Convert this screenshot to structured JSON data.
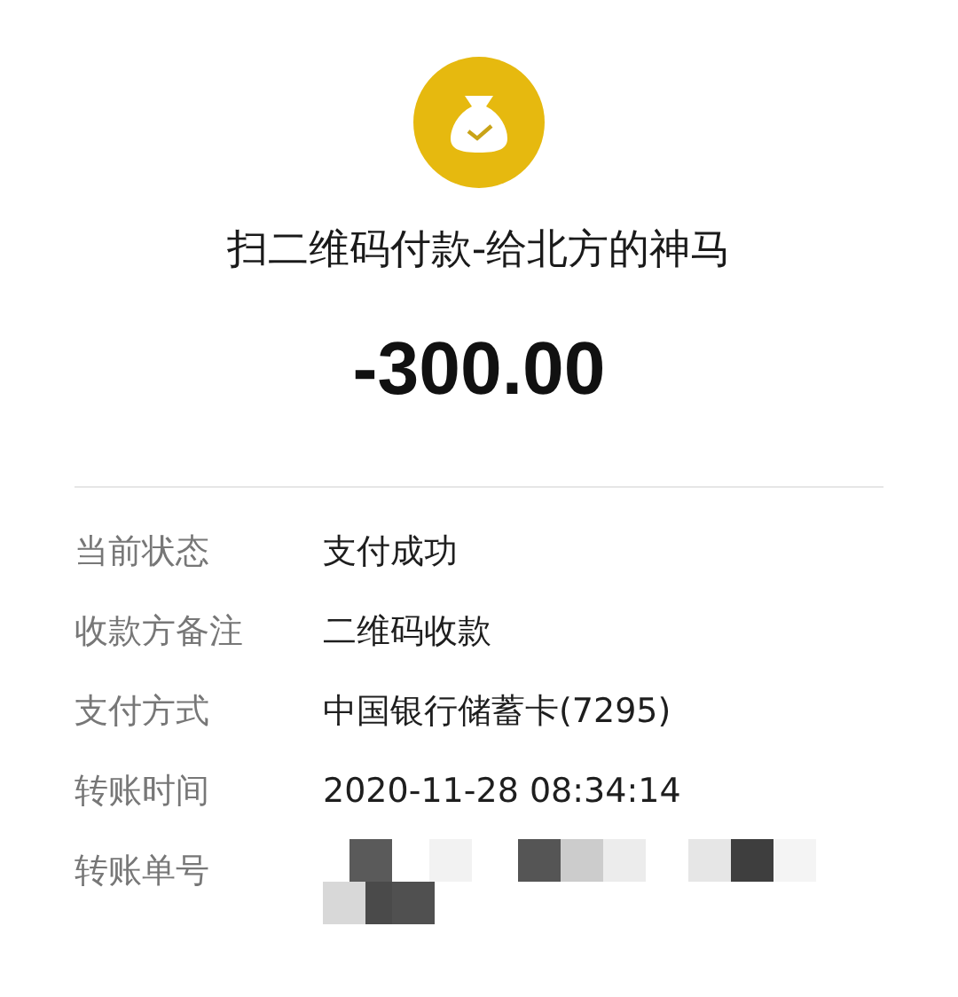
{
  "title": "扫二维码付款-给北方的神马",
  "amount": "-300.00",
  "details": [
    {
      "kind": "text",
      "label": "当前状态",
      "value": "支付成功"
    },
    {
      "kind": "text",
      "label": "收款方备注",
      "value": "二维码收款"
    },
    {
      "kind": "text",
      "label": "支付方式",
      "value": "中国银行储蓄卡(7295)"
    },
    {
      "kind": "text",
      "label": "转账时间",
      "value": "2020-11-28 08:34:14"
    },
    {
      "kind": "redacted",
      "label": "转账单号"
    }
  ]
}
